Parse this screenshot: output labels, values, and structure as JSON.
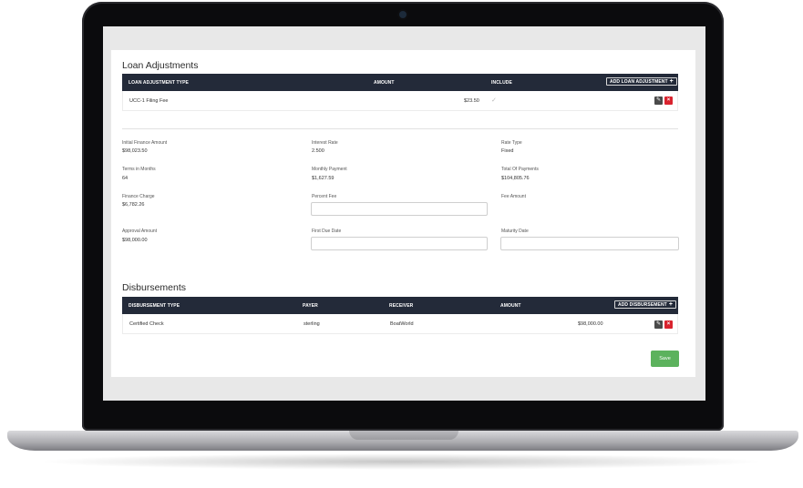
{
  "loan_adjustments": {
    "title": "Loan Adjustments",
    "columns": [
      "LOAN ADJUSTMENT TYPE",
      "AMOUNT",
      "INCLUDE"
    ],
    "add_label": "ADD LOAN ADJUSTMENT",
    "rows": [
      {
        "type": "UCC-1 Filing Fee",
        "amount": "$23.50",
        "include_icon": "check-icon"
      }
    ]
  },
  "fields": {
    "initial_finance_amount": {
      "label": "Initial Finance Amount",
      "value": "$98,023.50"
    },
    "interest_rate": {
      "label": "Interest Rate",
      "value": "2.500"
    },
    "rate_type": {
      "label": "Rate Type",
      "value": "Fixed"
    },
    "terms_in_months": {
      "label": "Terms in Months",
      "value": "64"
    },
    "monthly_payment": {
      "label": "Monthly Payment",
      "value": "$1,627.59"
    },
    "total_of_payments": {
      "label": "Total Of Payments",
      "value": "$104,805.76"
    },
    "finance_charge": {
      "label": "Finance Charge",
      "value": "$6,782.26"
    },
    "percent_fee": {
      "label": "Percent Fee",
      "value": ""
    },
    "fee_amount": {
      "label": "Fee Amount",
      "value": ""
    },
    "approval_amount": {
      "label": "Approval Amount",
      "value": "$98,000.00"
    },
    "first_due_date": {
      "label": "First Due Date",
      "value": ""
    },
    "maturity_date": {
      "label": "Maturity Date",
      "value": ""
    }
  },
  "disbursements": {
    "title": "Disbursements",
    "columns": [
      "DISBURSEMENT TYPE",
      "PAYER",
      "RECEIVER",
      "AMOUNT"
    ],
    "add_label": "ADD DISBURSEMENT",
    "rows": [
      {
        "type": "Certified Check",
        "payer": "sterling",
        "receiver": "BoatWorld",
        "amount": "$98,000.00"
      }
    ]
  },
  "actions": {
    "save_label": "Save"
  },
  "colors": {
    "table_header": "#232a39",
    "save": "#5cb25d",
    "delete": "#d9232e",
    "edit": "#4a4a4a"
  }
}
